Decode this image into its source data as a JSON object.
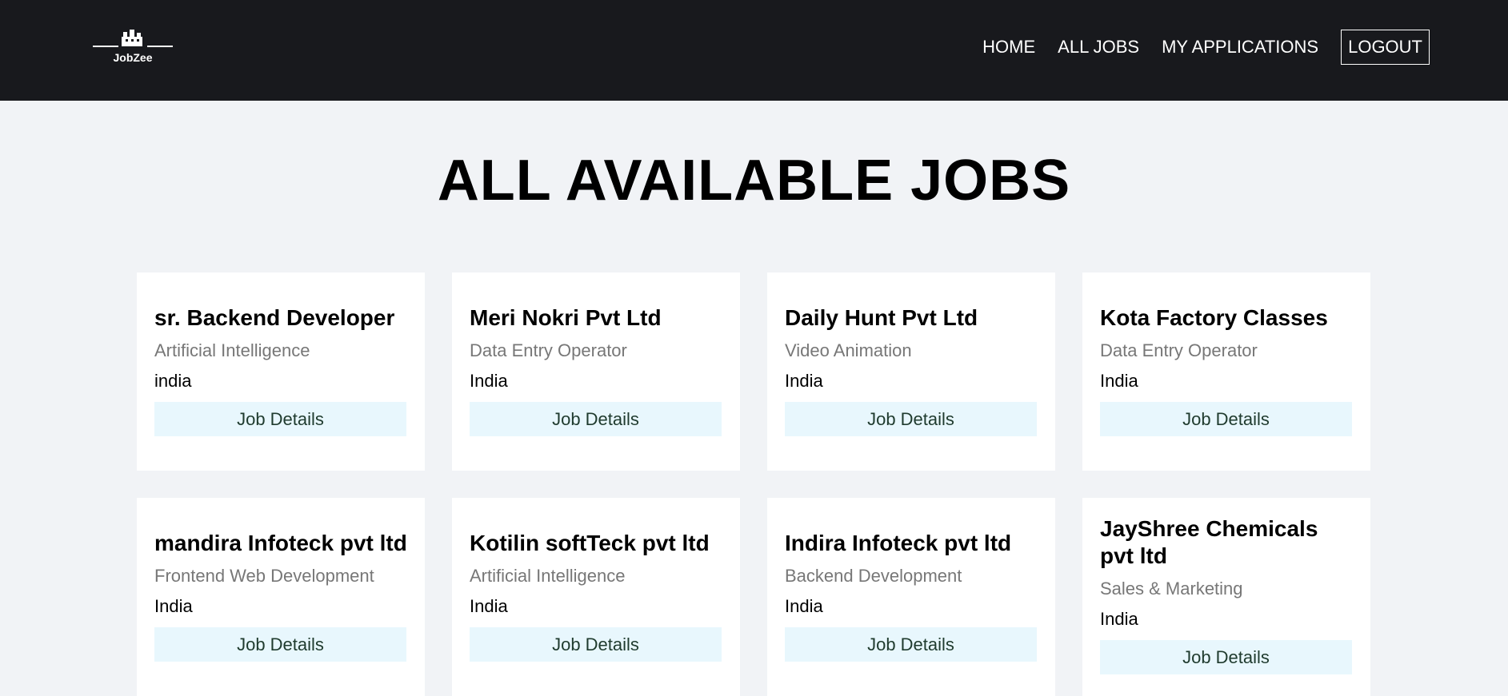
{
  "nav": {
    "logo_text": "JobZee",
    "links": [
      "HOME",
      "ALL JOBS",
      "MY APPLICATIONS"
    ],
    "logout": "LOGOUT"
  },
  "page": {
    "title": "ALL AVAILABLE JOBS"
  },
  "jobs": [
    {
      "title": "sr. Backend Developer",
      "category": "Artificial Intelligence",
      "location": "india",
      "button": "Job Details"
    },
    {
      "title": "Meri Nokri Pvt Ltd",
      "category": "Data Entry Operator",
      "location": "India",
      "button": "Job Details"
    },
    {
      "title": "Daily Hunt Pvt Ltd",
      "category": "Video Animation",
      "location": "India",
      "button": "Job Details"
    },
    {
      "title": "Kota Factory Classes",
      "category": "Data Entry Operator",
      "location": "India",
      "button": "Job Details"
    },
    {
      "title": "mandira Infoteck pvt ltd",
      "category": "Frontend Web Development",
      "location": "India",
      "button": "Job Details"
    },
    {
      "title": "Kotilin softTeck pvt ltd",
      "category": "Artificial Intelligence",
      "location": "India",
      "button": "Job Details"
    },
    {
      "title": "Indira Infoteck pvt ltd",
      "category": "Backend Development",
      "location": "India",
      "button": "Job Details"
    },
    {
      "title": "JayShree Chemicals pvt ltd",
      "category": "Sales & Marketing",
      "location": "India",
      "button": "Job Details"
    }
  ],
  "icons": {
    "logo": "building-icon"
  },
  "colors": {
    "navbar": "#18191d",
    "background": "#f1f3f6",
    "button": "#e8f7fd"
  }
}
